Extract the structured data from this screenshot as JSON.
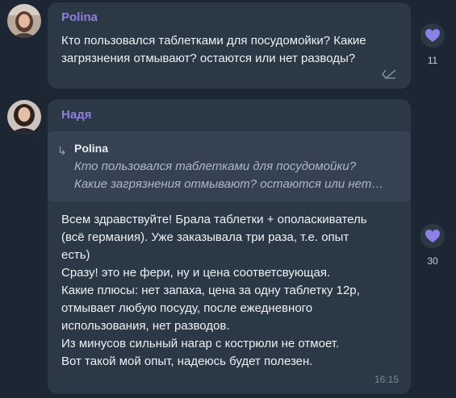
{
  "messages": [
    {
      "author": "Polina",
      "text": "Кто пользовался таблетками для посудомойки? Какие\nзагрязнения отмывают? остаются или нет разводы?",
      "reaction_count": "11"
    },
    {
      "author": "Надя",
      "quote_author": "Polina",
      "quote_text": "Кто пользовался таблетками для посудомойки?\nКакие загрязнения отмывают? остаются или нет…",
      "text": "Всем здравствуйте! Брала таблетки + ополаскиватель\n(всё германия). Уже заказывала три раза, т.е. опыт\nесть)\nСразу! это не фери, ну и цена соответсвующая.\nКакие плюсы: нет запаха, цена за одну таблетку 12р,\nотмывает любую посуду, после ежедневного\nиспользования, нет разводов.\nИз минусов сильный нагар с кострюли не отмоет.\nВот такой мой опыт, надеюсь будет полезен.",
      "time": "16:15",
      "reaction_count": "30"
    }
  ],
  "colors": {
    "background": "#1d2733",
    "bubble": "#2b3846",
    "author": "#8f7de0",
    "heart": "#8b7fe8"
  },
  "icons": [
    "heart-icon",
    "reply-icon",
    "reply-arrow-icon",
    "avatar"
  ]
}
